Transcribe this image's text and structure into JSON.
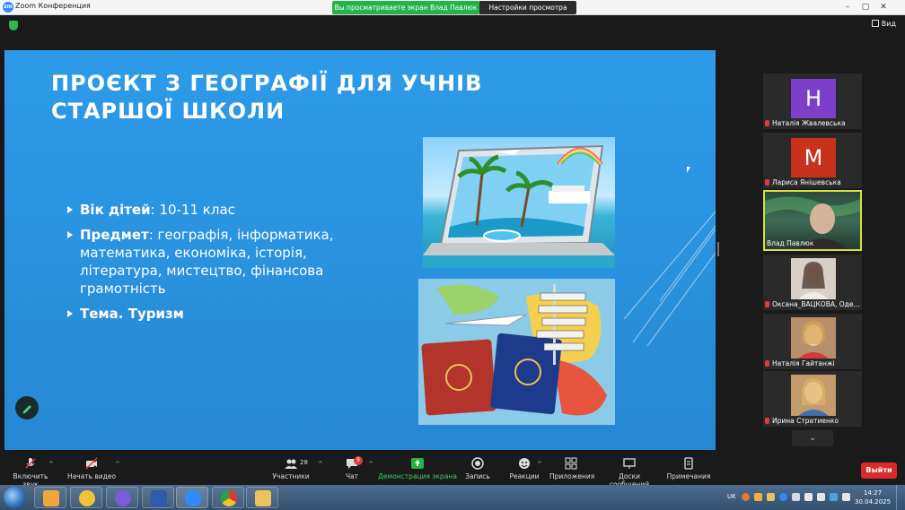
{
  "window": {
    "app_title": "Zoom Конференция",
    "share_banner": "Вы просматриваете экран Влад Павлюк",
    "view_options": "Настройки просмотра",
    "logo_text": "zm"
  },
  "meeting_header": {
    "view_label": "Вид"
  },
  "slide": {
    "title_line1": "ПРОЄКТ З ГЕОГРАФІЇ ДЛЯ УЧНІВ",
    "title_line2": "СТАРШОЇ ШКОЛИ",
    "bullets": [
      {
        "label": "Вік дітей",
        "text": ": 10-11 клас"
      },
      {
        "label": "Предмет",
        "text": ": географія, інформатика, математика, економіка, історія, література, мистецтво, фінансова грамотність"
      },
      {
        "label": "Тема. Туризм",
        "text": ""
      }
    ]
  },
  "participants": [
    {
      "name": "Наталія Жвалевська",
      "initial": "Н",
      "color": "#7b3fc9",
      "muted": true
    },
    {
      "name": "Лариса Янішевська",
      "initial": "М",
      "color": "#c8321d",
      "muted": true
    },
    {
      "name": "Влад Павлюк",
      "initial": "",
      "color": "#2f4a3c",
      "muted": false,
      "active": true
    },
    {
      "name": "Оксана_ВАЦКОВА, Оде...",
      "initial": "",
      "color": "#d8cfc6",
      "muted": true
    },
    {
      "name": "Наталія Гайтанжі",
      "initial": "",
      "color": "#c9a27c",
      "muted": true
    },
    {
      "name": "Ирина Стратиенко",
      "initial": "",
      "color": "#d8b98c",
      "muted": true
    }
  ],
  "toolbar": {
    "audio_label": "Включить звук",
    "video_label": "Начать видео",
    "participants_label": "Участники",
    "participants_count": "28",
    "chat_label": "Чат",
    "chat_badge": "9",
    "share_label": "Демонстрация экрана",
    "record_label": "Запись",
    "reactions_label": "Реакции",
    "apps_label": "Приложения",
    "whiteboards_label": "Доски сообщений",
    "notes_label": "Примечания",
    "leave_label": "Выйти"
  },
  "taskbar": {
    "language": "UK",
    "time": "14:27",
    "date": "30.04.2025"
  },
  "colors": {
    "share_green": "#23b34a",
    "leave_red": "#d92b2b",
    "slide_blue": "#2a94e0",
    "active_border": "#d8e03c"
  }
}
